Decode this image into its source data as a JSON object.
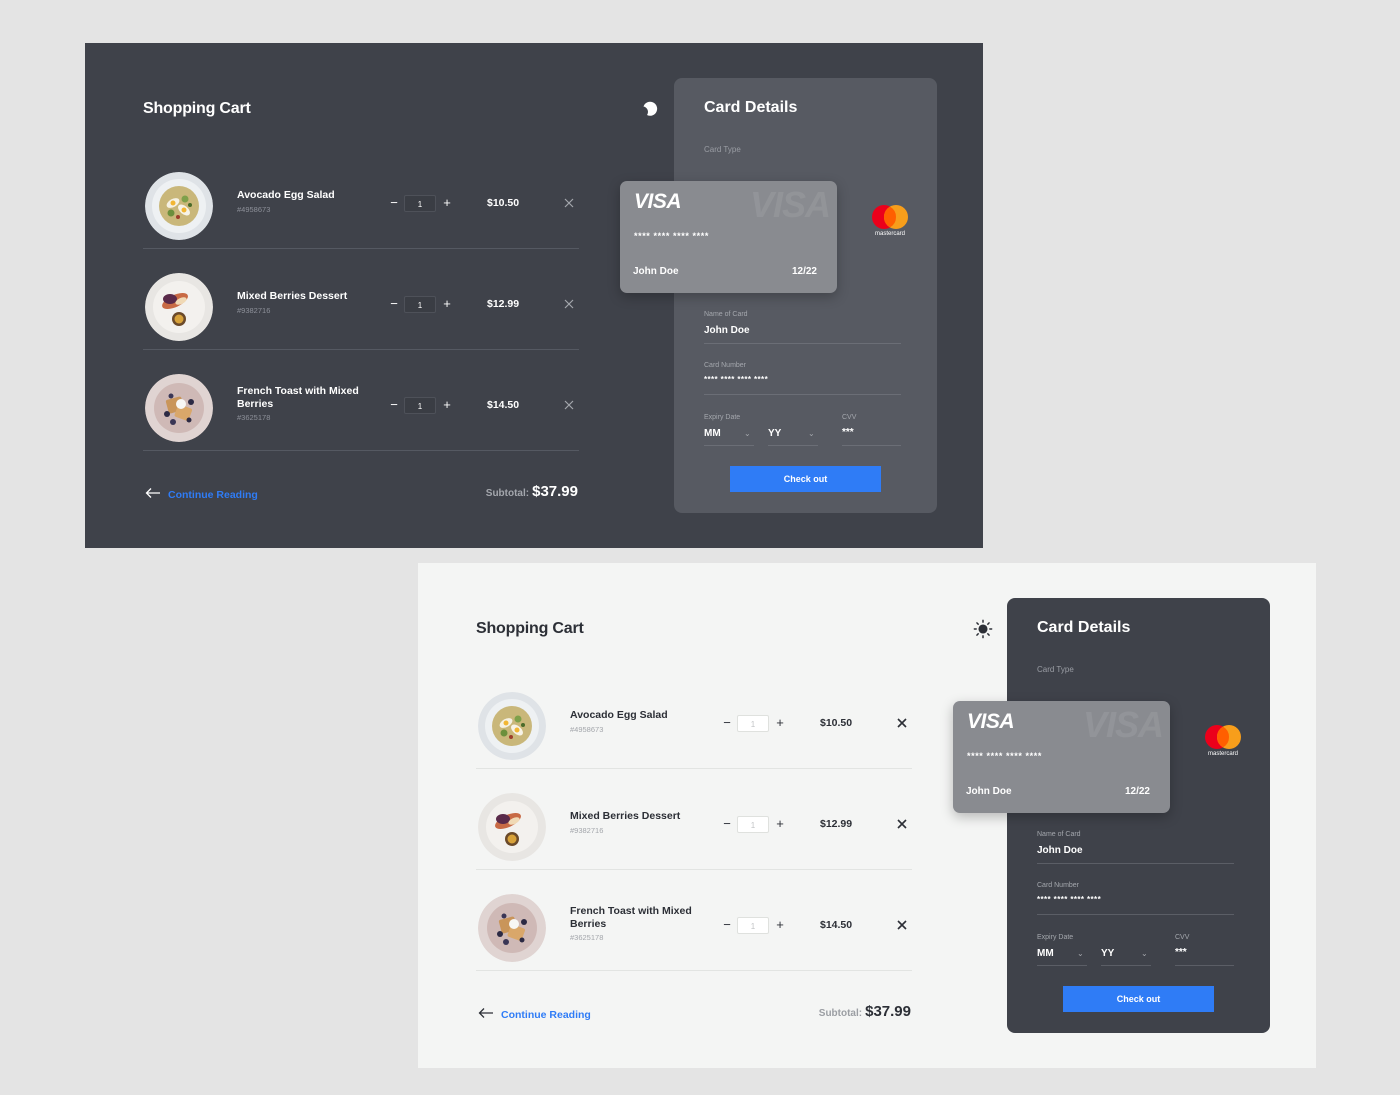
{
  "dark_panel": {
    "cart_title": "Shopping Cart",
    "items": [
      {
        "name": "Avocado Egg Salad",
        "sku": "#4958673",
        "qty": "1",
        "price": "$10.50"
      },
      {
        "name": "Mixed Berries Dessert",
        "sku": "#9382716",
        "qty": "1",
        "price": "$12.99"
      },
      {
        "name": "French Toast with Mixed Berries",
        "sku": "#3625178",
        "qty": "1",
        "price": "$14.50"
      }
    ],
    "qty_minus": "−",
    "qty_plus": "+",
    "continue_label": "Continue Reading",
    "subtotal_label": "Subtotal:",
    "subtotal_value": "$37.99",
    "theme_icon": "moon-icon",
    "card_details": {
      "title": "Card Details",
      "card_type_label": "Card Type",
      "visa_logo": "VISA",
      "visa_number": "**** **** **** ****",
      "visa_name": "John Doe",
      "visa_expiry": "12/22",
      "mastercard_label": "mastercard",
      "name_label": "Name of Card",
      "name_value": "John Doe",
      "number_label": "Card Number",
      "number_value": "**** **** **** ****",
      "expiry_label": "Expiry Date",
      "month_value": "MM",
      "year_value": "YY",
      "cvv_label": "CVV",
      "cvv_value": "***",
      "checkout_label": "Check out"
    }
  },
  "light_panel": {
    "cart_title": "Shopping Cart",
    "items": [
      {
        "name": "Avocado Egg Salad",
        "sku": "#4958673",
        "qty": "1",
        "price": "$10.50"
      },
      {
        "name": "Mixed Berries Dessert",
        "sku": "#9382716",
        "qty": "1",
        "price": "$12.99"
      },
      {
        "name": "French Toast with Mixed Berries",
        "sku": "#3625178",
        "qty": "1",
        "price": "$14.50"
      }
    ],
    "qty_minus": "−",
    "qty_plus": "+",
    "continue_label": "Continue Reading",
    "subtotal_label": "Subtotal:",
    "subtotal_value": "$37.99",
    "theme_icon": "sun-icon",
    "card_details": {
      "title": "Card Details",
      "card_type_label": "Card Type",
      "visa_logo": "VISA",
      "visa_number": "**** **** **** ****",
      "visa_name": "John Doe",
      "visa_expiry": "12/22",
      "mastercard_label": "mastercard",
      "name_label": "Name of Card",
      "name_value": "John Doe",
      "number_label": "Card Number",
      "number_value": "**** **** **** ****",
      "expiry_label": "Expiry Date",
      "month_value": "MM",
      "year_value": "YY",
      "cvv_label": "CVV",
      "cvv_value": "***",
      "checkout_label": "Check out"
    }
  },
  "colors": {
    "accent": "#2f7cf6",
    "dark_bg": "#3f424a",
    "light_bg": "#f4f5f4",
    "visa_card": "#898b90",
    "mastercard_red": "#eb001b",
    "mastercard_orange": "#f79e1b"
  }
}
